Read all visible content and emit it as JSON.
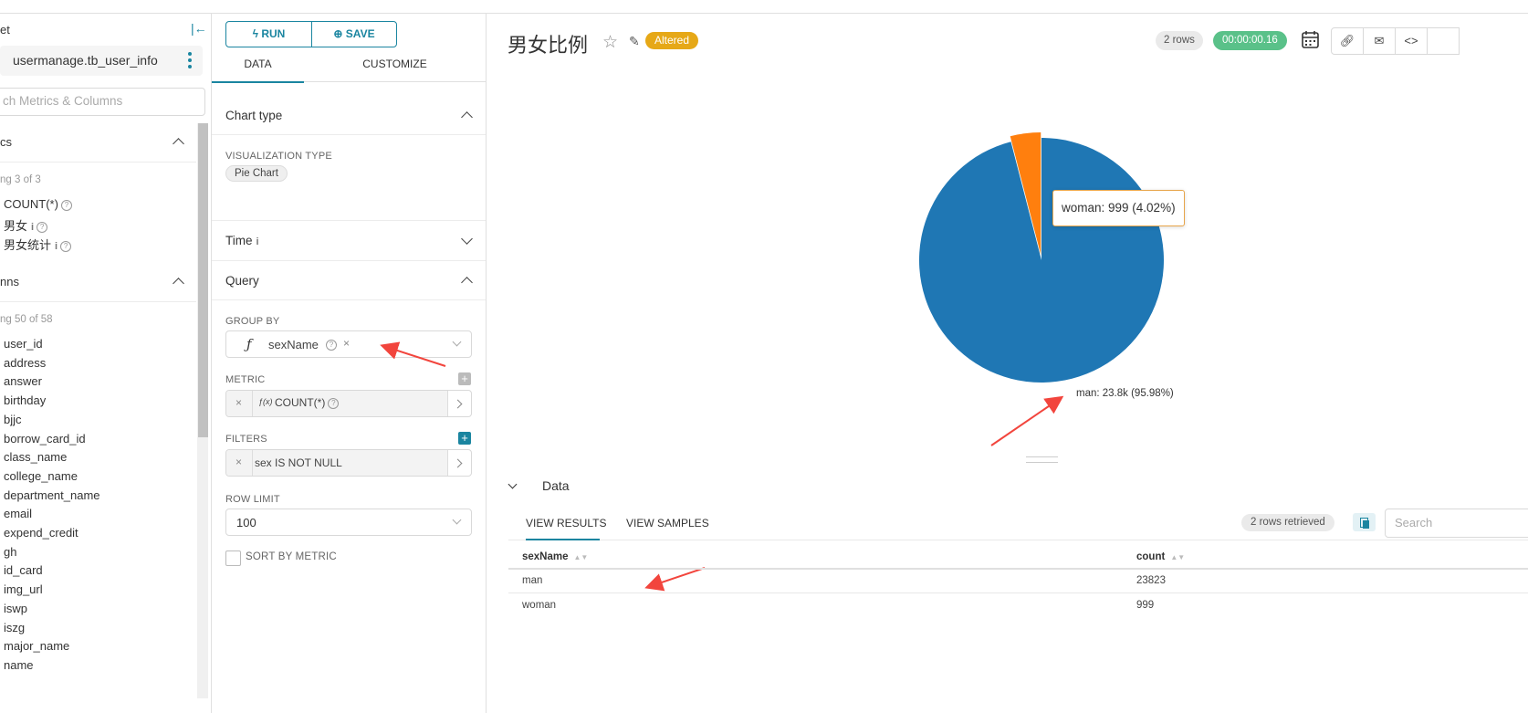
{
  "left_panel": {
    "dataset_label": "et",
    "dataset_name": "usermanage.tb_user_info",
    "search_placeholder": "ch Metrics & Columns",
    "metrics": {
      "title": "cs",
      "showing": "ng 3 of 3",
      "items": [
        "COUNT(*)",
        "男女",
        "男女统计"
      ]
    },
    "columns": {
      "title": "nns",
      "showing": "ng 50 of 58",
      "items": [
        "user_id",
        "address",
        "answer",
        "birthday",
        "bjjc",
        "borrow_card_id",
        "class_name",
        "college_name",
        "department_name",
        "email",
        "expend_credit",
        "gh",
        "id_card",
        "img_url",
        "iswp",
        "iszg",
        "major_name",
        "name"
      ]
    }
  },
  "controls": {
    "run_label": "RUN",
    "save_label": "SAVE",
    "tab_data": "DATA",
    "tab_customize": "CUSTOMIZE",
    "chart_type_title": "Chart type",
    "viz_type_label": "VISUALIZATION TYPE",
    "viz_type_value": "Pie Chart",
    "time_title": "Time",
    "query_title": "Query",
    "group_by_label": "GROUP BY",
    "group_by_value": "sexName",
    "metric_label": "METRIC",
    "metric_value": "COUNT(*)",
    "filters_label": "FILTERS",
    "filter_value": "sex IS NOT NULL",
    "row_limit_label": "ROW LIMIT",
    "row_limit_value": "100",
    "sort_by_metric_label": "SORT BY METRIC"
  },
  "header": {
    "title": "男女比例",
    "altered_badge": "Altered",
    "rows_badge": "2 rows",
    "time_badge": "00:00:00.16"
  },
  "chart_data": {
    "type": "pie",
    "slices": [
      {
        "label": "man",
        "value": 23823,
        "display": "man: 23.8k (95.98%)",
        "color": "#1f77b4"
      },
      {
        "label": "woman",
        "value": 999,
        "display": "woman: 999 (4.02%)",
        "color": "#ff7f0e"
      }
    ],
    "tooltip": "woman: 999 (4.02%)"
  },
  "data_panel": {
    "title": "Data",
    "tab_results": "VIEW RESULTS",
    "tab_samples": "VIEW SAMPLES",
    "retrieved": "2 rows retrieved",
    "search_placeholder": "Search",
    "columns": [
      "sexName",
      "count"
    ],
    "rows": [
      [
        "man",
        "23823"
      ],
      [
        "woman",
        "999"
      ]
    ]
  },
  "colors": {
    "accent": "#1a85a0",
    "altered": "#e6a817",
    "success": "#5ac189",
    "annotation_arrow": "#f2453d"
  }
}
